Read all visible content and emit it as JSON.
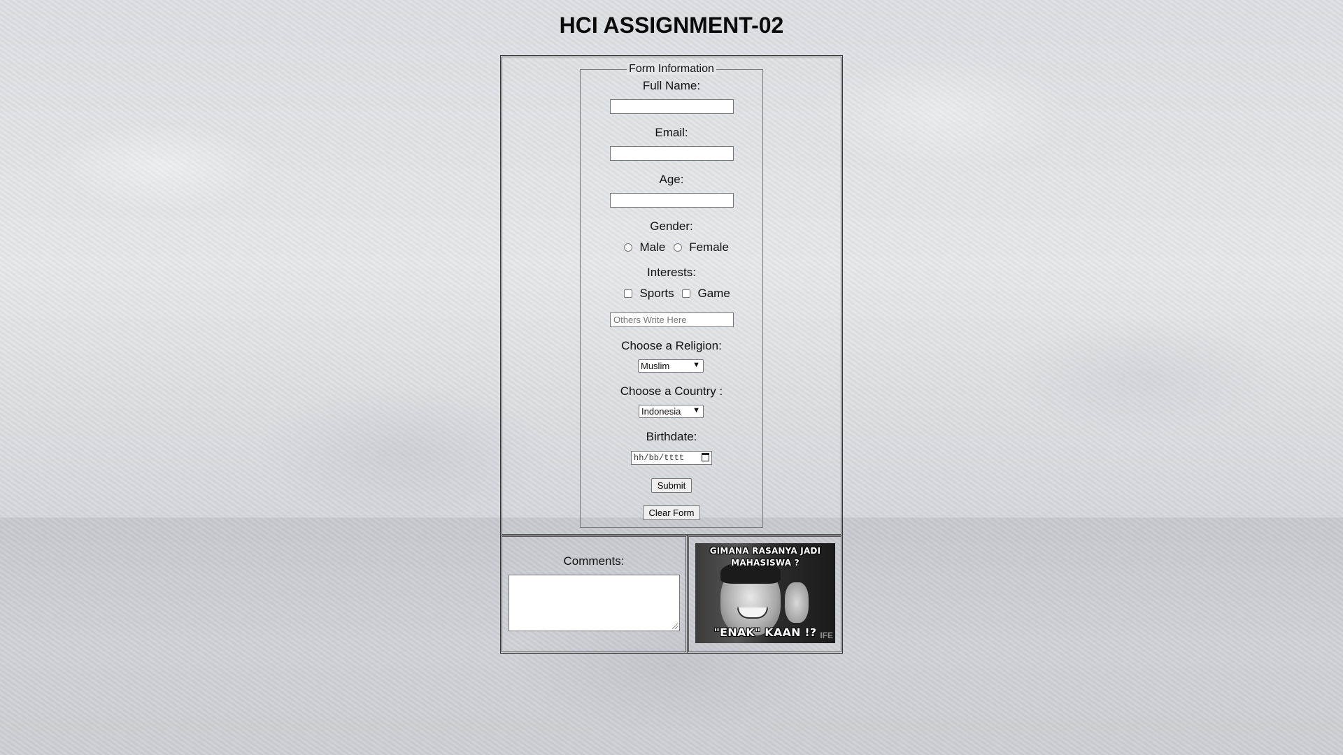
{
  "page": {
    "title": "HCI ASSIGNMENT-02"
  },
  "form": {
    "legend": "Form Information",
    "full_name": {
      "label": "Full Name:",
      "value": ""
    },
    "email": {
      "label": "Email:",
      "value": ""
    },
    "age": {
      "label": "Age:",
      "value": ""
    },
    "gender": {
      "label": "Gender:",
      "options": [
        "Male",
        "Female"
      ],
      "selected": null
    },
    "interests": {
      "label": "Interests:",
      "options": [
        "Sports",
        "Game"
      ],
      "checked": [],
      "others_placeholder": "Others Write Here"
    },
    "religion": {
      "label": "Choose a Religion:",
      "selected": "Muslim"
    },
    "country": {
      "label": "Choose a Country :",
      "selected": "Indonesia"
    },
    "birthdate": {
      "label": "Birthdate:",
      "placeholder": "hh/bb/tttt"
    },
    "submit_label": "Submit",
    "clear_label": "Clear Form"
  },
  "comments": {
    "label": "Comments:",
    "value": ""
  },
  "meme": {
    "caption_top": "GIMANA RASANYA JADI MAHASISWA ?",
    "caption_bottom": "\"ENAK\" KAAN !?",
    "watermark": "IFE"
  },
  "colors": {
    "text": "#111111",
    "border": "#333333",
    "input_bg": "#ffffff",
    "button_bg": "#efefef"
  }
}
